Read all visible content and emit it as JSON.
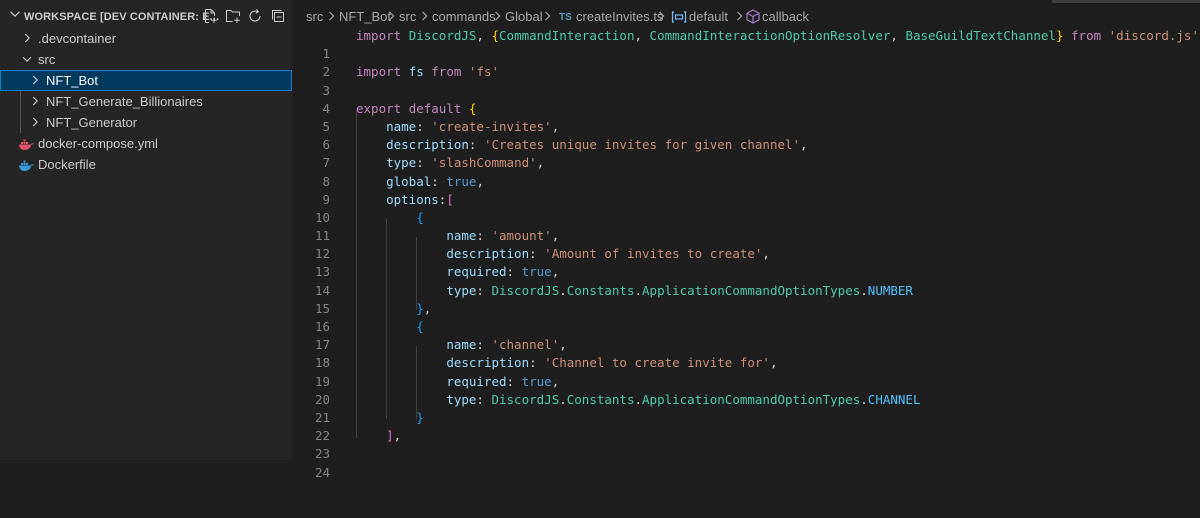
{
  "explorer": {
    "title": "WORKSPACE [DEV CONTAINER: E...",
    "header_actions": [
      "new-file-icon",
      "new-folder-icon",
      "refresh-icon",
      "collapse-all-icon"
    ],
    "items": [
      {
        "label": ".devcontainer",
        "type": "folder",
        "expanded": false
      },
      {
        "label": "src",
        "type": "folder",
        "expanded": true
      },
      {
        "label": "NFT_Bot",
        "type": "folder",
        "expanded": false,
        "selected": true
      },
      {
        "label": "NFT_Generate_Billionaires",
        "type": "folder",
        "expanded": false
      },
      {
        "label": "NFT_Generator",
        "type": "folder",
        "expanded": false
      },
      {
        "label": "docker-compose.yml",
        "type": "file",
        "icon": "docker-compose-icon"
      },
      {
        "label": "Dockerfile",
        "type": "file",
        "icon": "docker-icon"
      }
    ]
  },
  "breadcrumb": {
    "items": [
      "src",
      "NFT_Bot",
      "src",
      "commands",
      "Global",
      "createInvites.ts",
      "default",
      "callback"
    ],
    "file_badge": "TS",
    "accent": "#3178c6"
  },
  "editor": {
    "line_numbers": [
      "1",
      "2",
      "3",
      "4",
      "5",
      "6",
      "7",
      "8",
      "9",
      "10",
      "11",
      "12",
      "13",
      "14",
      "15",
      "16",
      "17",
      "18",
      "19",
      "20",
      "21",
      "22",
      "23",
      "24"
    ],
    "code_lines": [
      "import DiscordJS, {CommandInteraction, CommandInteractionOptionResolver, BaseGuildTextChannel} from 'discord.js'",
      "",
      "import fs from 'fs'",
      "",
      "export default {",
      "    name: 'create-invites',",
      "    description: 'Creates unique invites for given channel',",
      "    type: 'slashCommand',",
      "    global: true,",
      "    options:[",
      "        {",
      "            name: 'amount',",
      "            description: 'Amount of invites to create',",
      "            required: true,",
      "            type: DiscordJS.Constants.ApplicationCommandOptionTypes.NUMBER",
      "        },",
      "        {",
      "            name: 'channel',",
      "            description: 'Channel to create invite for',",
      "            required: true,",
      "            type: DiscordJS.Constants.ApplicationCommandOptionTypes.CHANNEL",
      "        }",
      "    ],",
      ""
    ]
  },
  "colors": {
    "background": "#1e1e1e",
    "sidebar": "#252526",
    "selection": "#04395e",
    "keyword": "#c586c0",
    "string": "#ce9178",
    "property": "#9cdcfe",
    "type": "#4ec9b0",
    "boolean": "#569cd6"
  }
}
